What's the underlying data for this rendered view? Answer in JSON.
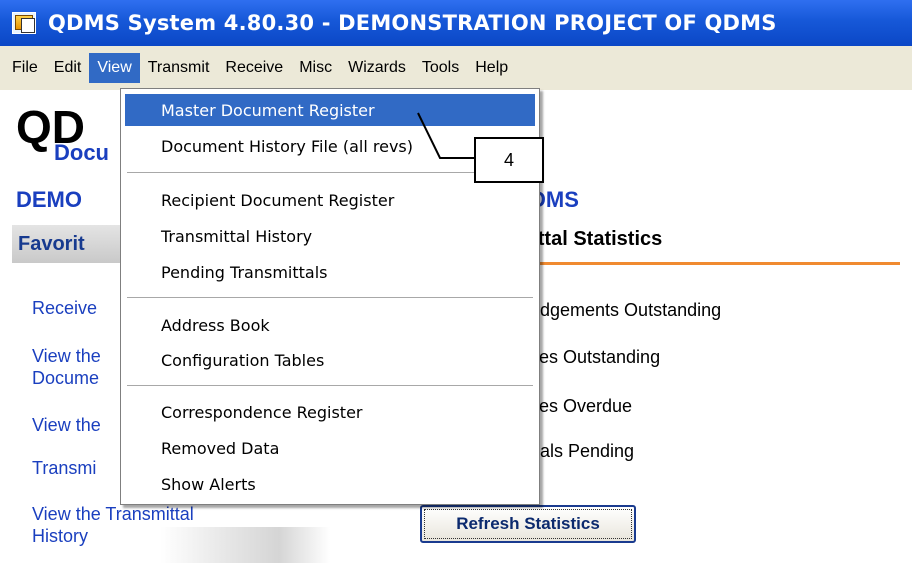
{
  "window": {
    "title": "QDMS System 4.80.30 - DEMONSTRATION PROJECT OF QDMS"
  },
  "menubar": {
    "items": [
      "File",
      "Edit",
      "View",
      "Transmit",
      "Receive",
      "Misc",
      "Wizards",
      "Tools",
      "Help"
    ],
    "active": "View"
  },
  "background": {
    "logo": "QD",
    "logo_sub": "Docu",
    "project_left": "DEMO",
    "project_right": "DMS",
    "favorites_header": "Favorit",
    "stats_header": "nittal Statistics",
    "links": [
      {
        "lines": [
          "Receive"
        ]
      },
      {
        "lines": [
          "View the",
          "Docume"
        ]
      },
      {
        "lines": [
          "View the"
        ]
      },
      {
        "lines": [
          "Transmi"
        ]
      },
      {
        "lines": [
          "View the Transmittal",
          "History"
        ]
      }
    ],
    "stats": [
      "ledgements Outstanding",
      "ises Outstanding",
      "ises Overdue",
      "ittals Pending"
    ],
    "refresh_button": "Refresh Statistics"
  },
  "view_menu": {
    "groups": [
      [
        "Master Document Register",
        "Document History File (all revs)"
      ],
      [
        "Recipient Document Register",
        "Transmittal History",
        "Pending Transmittals"
      ],
      [
        "Address Book",
        "Configuration Tables"
      ],
      [
        "Correspondence Register",
        "Removed Data",
        "Show Alerts"
      ]
    ],
    "highlighted": "Master Document Register"
  },
  "callout": {
    "label": "4"
  },
  "colors": {
    "titlebar": "#1658d8",
    "menu_highlight": "#316ac5",
    "link": "#1a3fbf",
    "accent_underline": "#f08a30"
  }
}
